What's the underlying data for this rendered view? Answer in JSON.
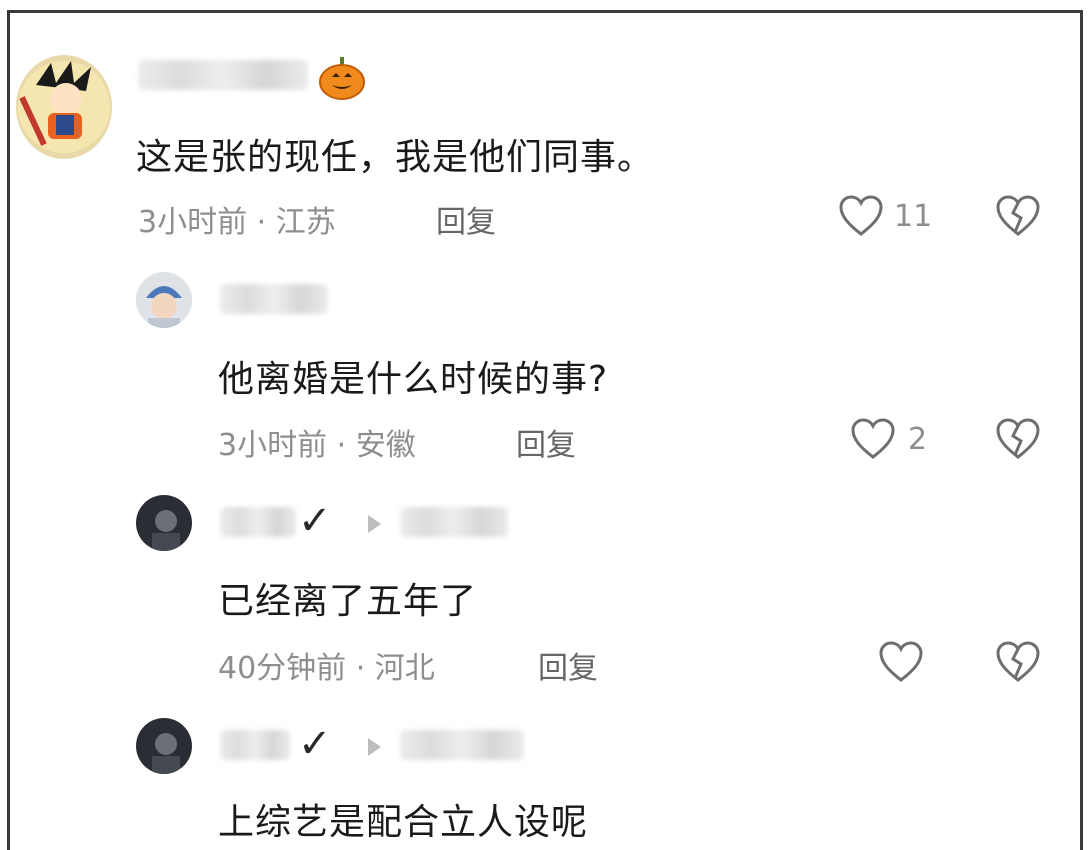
{
  "comments": [
    {
      "text": "这是张的现任，我是他们同事。",
      "meta": "3小时前 · 江苏",
      "reply_label": "回复",
      "likes": "11"
    },
    {
      "text": "他离婚是什么时候的事?",
      "meta": "3小时前 · 安徽",
      "reply_label": "回复",
      "likes": "2"
    },
    {
      "text": "已经离了五年了",
      "meta": "40分钟前 · 河北",
      "reply_label": "回复",
      "likes": ""
    },
    {
      "text": "上综艺是配合立人设呢"
    }
  ],
  "badge_icon": "pumpkin-icon",
  "colors": {
    "text": "#1a1a1a",
    "meta": "#8e8e8e",
    "border": "#3a3a3a"
  }
}
